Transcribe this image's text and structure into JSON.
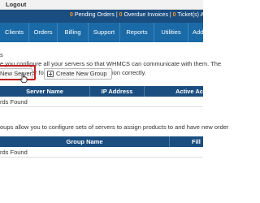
{
  "topbar": {
    "logout": "Logout"
  },
  "statusbar": {
    "pending_orders_count": "0",
    "pending_orders_label": "Pending Orders |",
    "overdue_invoices_count": "0",
    "overdue_invoices_label": "Overdue Invoices |",
    "tickets_count": "0",
    "tickets_label": "Ticket(s) Awaiting Rep"
  },
  "nav": [
    "Clients",
    "Orders",
    "Billing",
    "Support",
    "Reports",
    "Utilities",
    "Add"
  ],
  "intro": {
    "line1": "s",
    "line2": "e you configure all your servers so that WHMCS can communicate with them. The",
    "line3": "default server for automatic setup to function correctly."
  },
  "buttons": {
    "add_server": "New Server",
    "create_group": "Create New Group"
  },
  "servers_table": {
    "headers": [
      "Server Name",
      "IP Address",
      "Active Acc"
    ],
    "empty": "rds Found"
  },
  "groups_text": "oups allow you to configure sets of servers to assign products to and have new order",
  "groups_table": {
    "headers": [
      "Group Name",
      "Fill"
    ],
    "empty": "rds Found"
  }
}
